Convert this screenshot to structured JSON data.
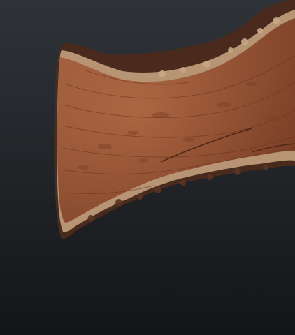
{
  "scene": {
    "subject": "live-edge-wood-slab",
    "colors": {
      "background_top": "#2f3338",
      "background_bottom": "#141518",
      "wood_dark": "#7a3d24",
      "wood_mid": "#9b5636",
      "wood_light": "#b56e48",
      "bark": "#4a2a1d",
      "sapwood": "#c9a784",
      "grain_line": "#6a321c",
      "crack": "#3d1d12"
    }
  }
}
